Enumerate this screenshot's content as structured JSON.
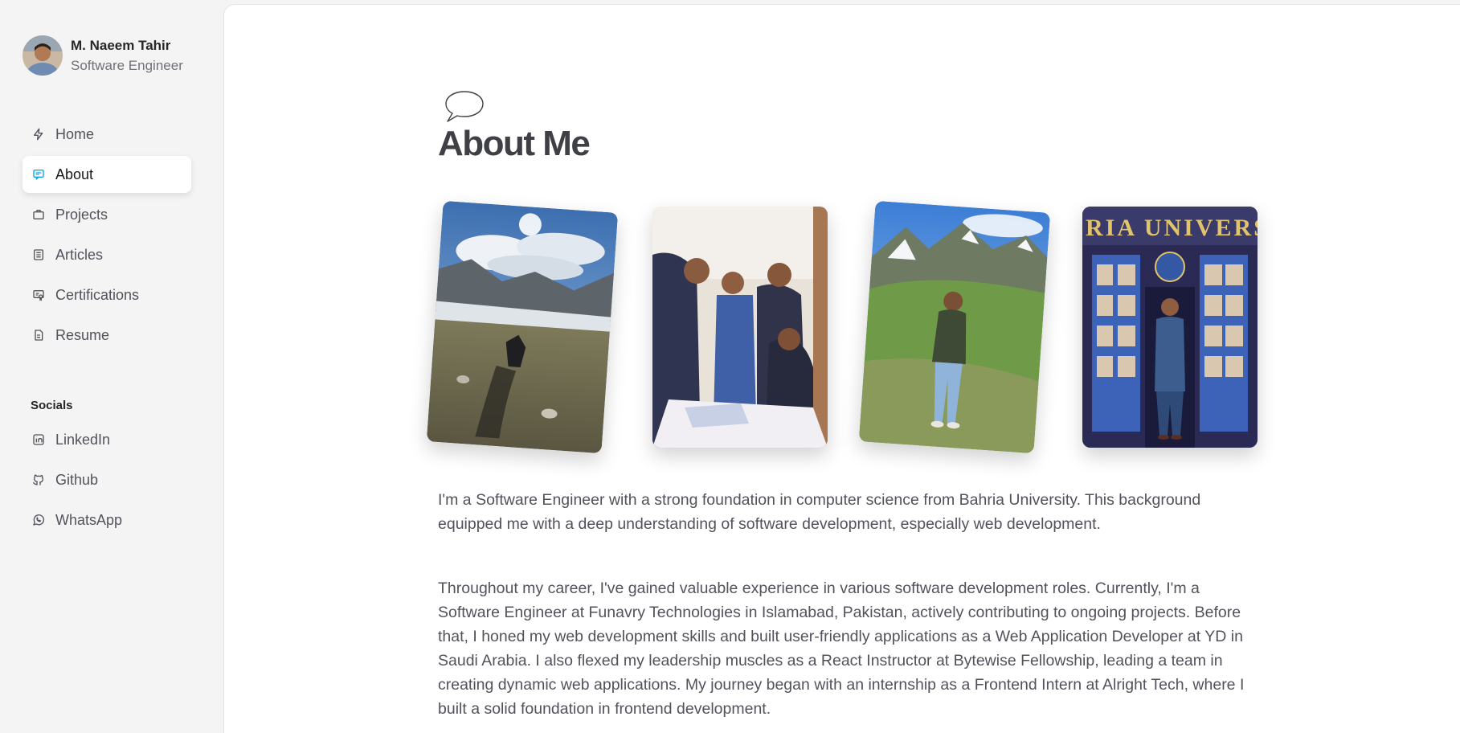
{
  "profile": {
    "name": "M. Naeem Tahir",
    "role": "Software Engineer"
  },
  "nav": [
    {
      "label": "Home",
      "icon": "bolt-icon"
    },
    {
      "label": "About",
      "icon": "chat-icon",
      "active": true
    },
    {
      "label": "Projects",
      "icon": "briefcase-icon"
    },
    {
      "label": "Articles",
      "icon": "document-list-icon"
    },
    {
      "label": "Certifications",
      "icon": "certificate-icon"
    },
    {
      "label": "Resume",
      "icon": "file-icon"
    }
  ],
  "socials": {
    "title": "Socials",
    "items": [
      {
        "label": "LinkedIn",
        "icon": "linkedin-icon"
      },
      {
        "label": "Github",
        "icon": "github-icon"
      },
      {
        "label": "WhatsApp",
        "icon": "whatsapp-icon"
      }
    ]
  },
  "main": {
    "title": "About Me",
    "photos": [
      "mountain-lake-photo",
      "signing-event-photo",
      "mountain-meadow-photo",
      "university-photo"
    ],
    "photo4_text": "RIA UNIVERS",
    "paragraphs": [
      "I'm a Software Engineer with a strong foundation in computer science from Bahria University. This background equipped me with a deep understanding of software development, especially web development.",
      "Throughout my career, I've gained valuable experience in various software development roles. Currently, I'm a Software Engineer at Funavry Technologies in Islamabad, Pakistan, actively contributing to ongoing projects. Before that, I honed my web development skills and built user-friendly applications as a Web Application Developer at YD in Saudi Arabia. I also flexed my leadership muscles as a React Instructor at Bytewise Fellowship, leading a team in creating dynamic web applications. My journey began with an internship as a Frontend Intern at Alright Tech, where I built a solid foundation in frontend development."
    ]
  },
  "colors": {
    "accent": "#0ea5e9",
    "sidebar_bg": "#f4f4f5",
    "main_bg": "#ffffff"
  }
}
